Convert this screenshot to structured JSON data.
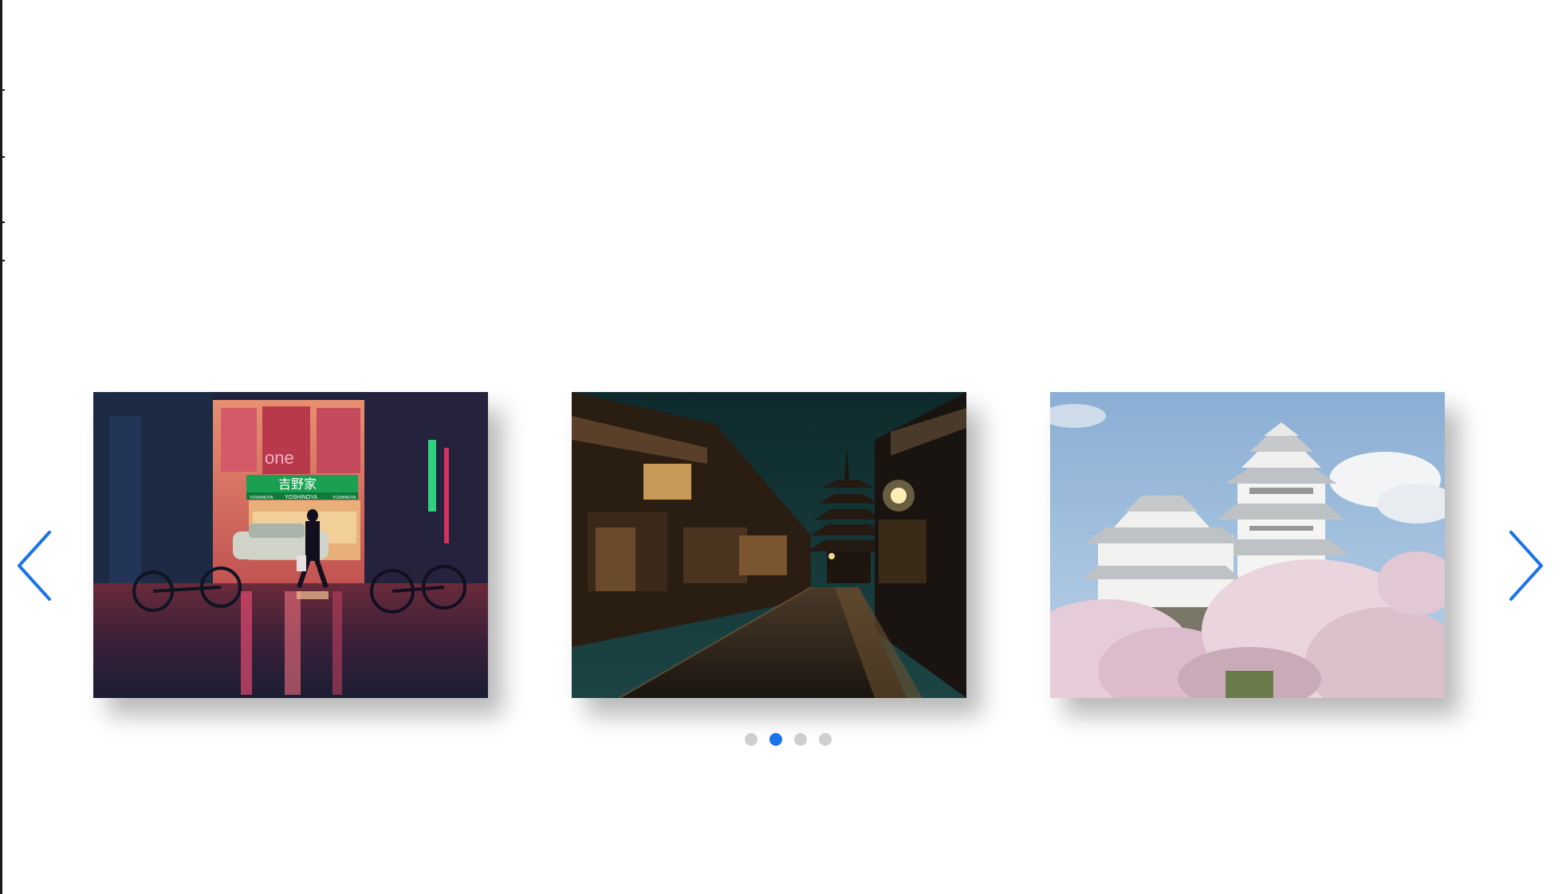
{
  "colors": {
    "accent": "#1a73e8",
    "dot_inactive": "#cfcfcf",
    "background": "#ffffff"
  },
  "carousel": {
    "active_index": 1,
    "slides": [
      {
        "icon": "photo-neon-rainy-street"
      },
      {
        "icon": "photo-pagoda-night-alley"
      },
      {
        "icon": "photo-castle-cherry-blossoms"
      }
    ],
    "dots_count": 4,
    "sign": {
      "kanji": "吉野家",
      "latin": "YOSHINOYA",
      "small": "YOSHINOYA",
      "poster": "one"
    },
    "prev_icon": "chevron-left-icon",
    "next_icon": "chevron-right-icon"
  }
}
